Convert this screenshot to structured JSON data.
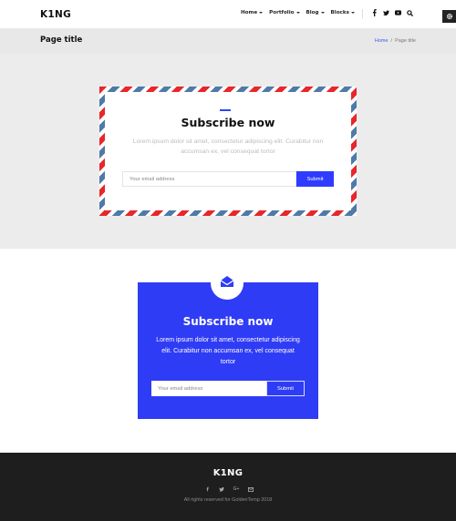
{
  "header": {
    "logo": "K1NG",
    "nav": [
      {
        "label": "Home"
      },
      {
        "label": "Portfolio"
      },
      {
        "label": "Blog"
      },
      {
        "label": "Blocks"
      }
    ],
    "social_icons": [
      "facebook-icon",
      "twitter-icon",
      "youtube-icon",
      "search-icon"
    ],
    "settings_icon": "gear-icon"
  },
  "titlebar": {
    "title": "Page title",
    "breadcrumb": {
      "home": "Home",
      "separator": "/",
      "current": "Page title"
    }
  },
  "envelope_subscribe": {
    "title": "Subscribe now",
    "text": "Lorem ipsum dolor sit amet, consectetur adipiscing elit. Curabitur non accumsan ex, vel consequat tortor",
    "input_placeholder": "Your email address",
    "submit_label": "Submit",
    "stripe_colors": [
      "#e8262b",
      "#4f7aa8"
    ]
  },
  "blue_subscribe": {
    "icon": "envelope-open-icon",
    "title": "Subscribe now",
    "text": "Lorem ipsum dolor sit amet, consectetur adipiscing elit. Curabitur non accumsan ex, vel consequat tortor",
    "input_placeholder": "Your email address",
    "submit_label": "Submit",
    "bg_color": "#2f3cf5"
  },
  "footer": {
    "logo": "K1NG",
    "social_icons": [
      "facebook-icon",
      "twitter-icon",
      "google-plus-icon",
      "email-icon"
    ],
    "google_plus_glyph": "G+",
    "copyright": "All rights reserved for GoldenTemp 2018"
  },
  "colors": {
    "accent": "#2f3cff",
    "footer_bg": "#1e1e1e",
    "titlebar_bg": "#e8e8e8"
  }
}
